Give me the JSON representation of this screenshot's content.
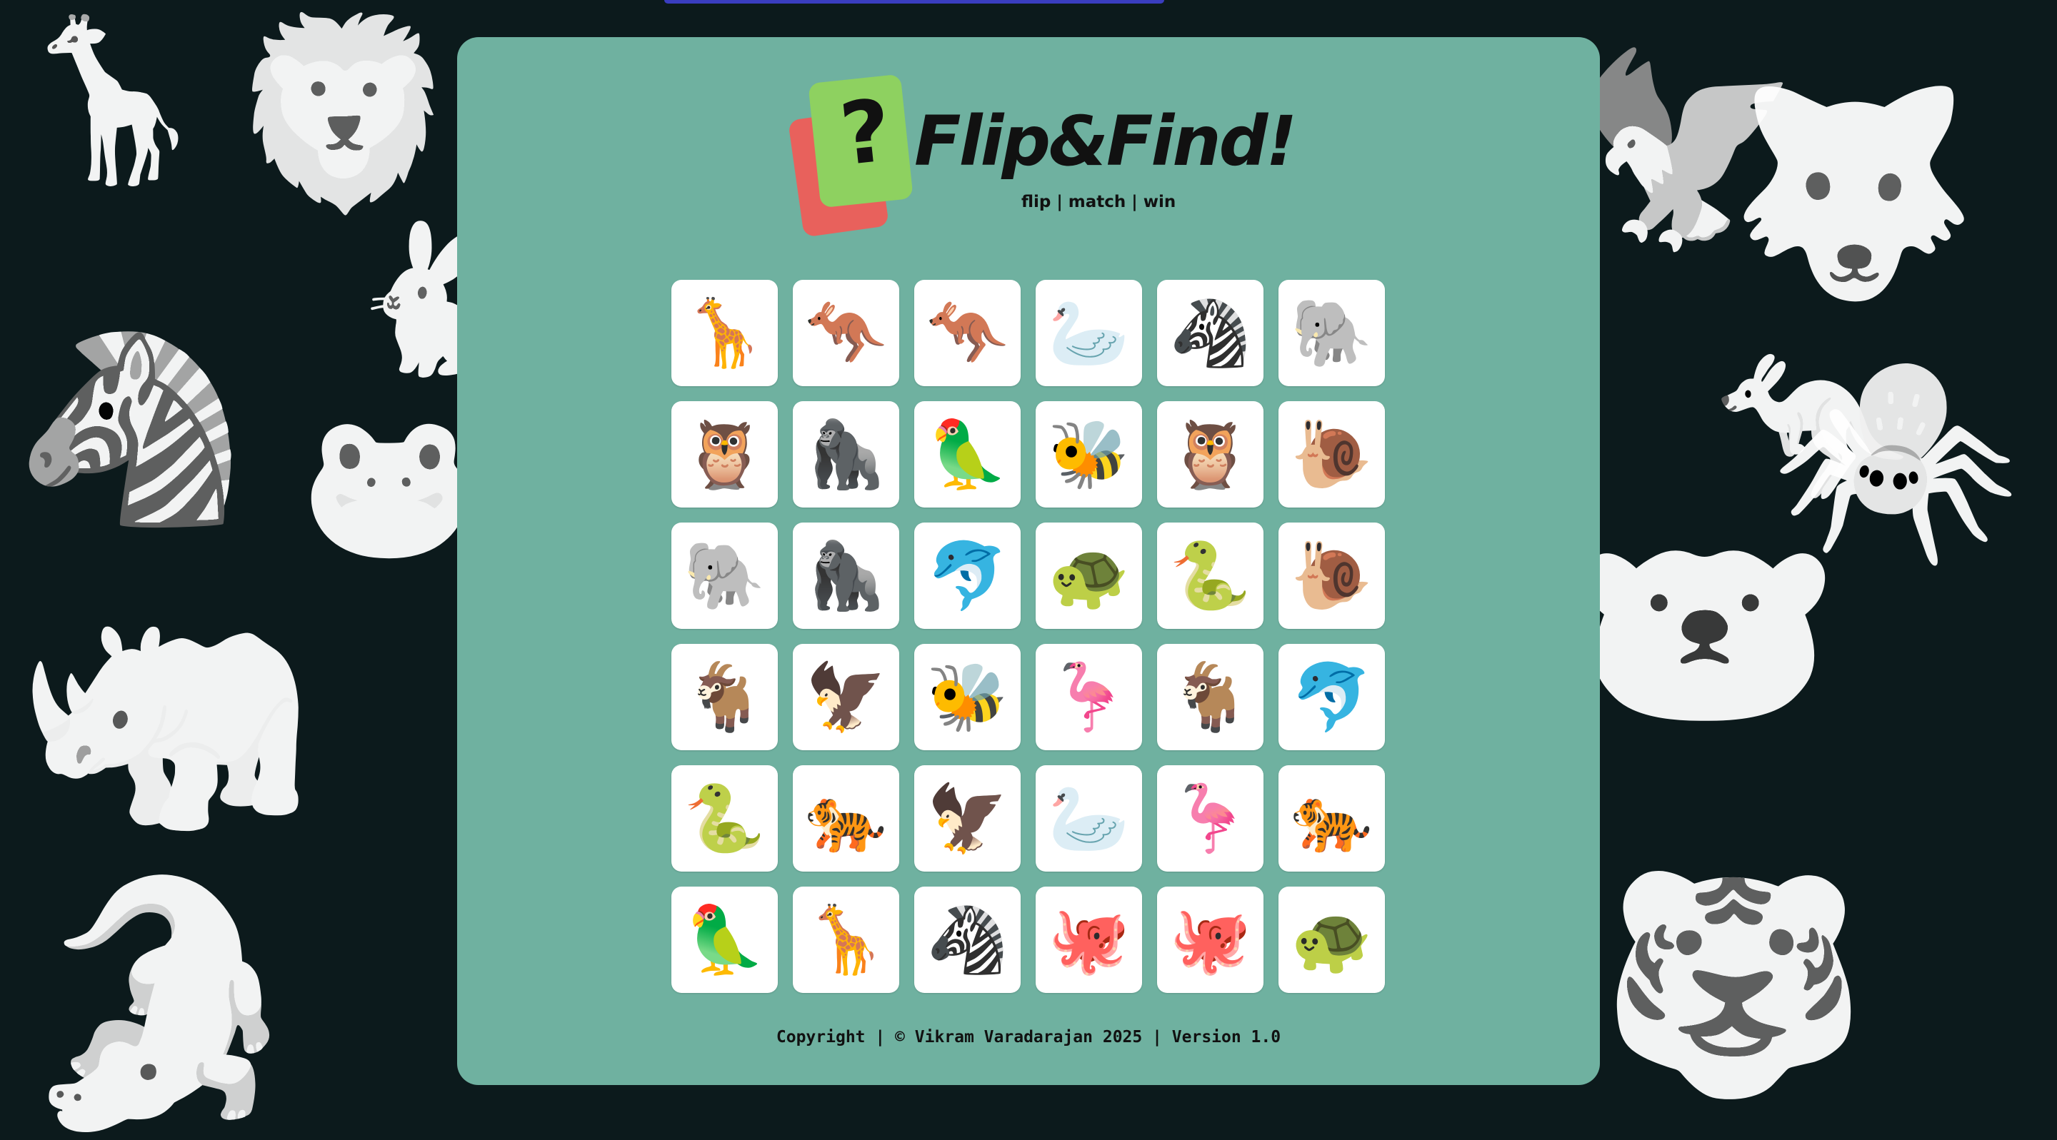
{
  "app": {
    "title": "Flip&Find!",
    "tagline": "flip | match | win"
  },
  "logo": {
    "question_mark": "?",
    "icon": "question-card-icon"
  },
  "background_animals": [
    {
      "glyph": "🦒",
      "name": "giraffe-icon"
    },
    {
      "glyph": "🦁",
      "name": "lion-icon"
    },
    {
      "glyph": "🐇",
      "name": "rabbit-icon"
    },
    {
      "glyph": "🦓",
      "name": "zebra-icon"
    },
    {
      "glyph": "🐸",
      "name": "frog-icon"
    },
    {
      "glyph": "🦏",
      "name": "rhino-icon"
    },
    {
      "glyph": "🐊",
      "name": "crocodile-icon"
    },
    {
      "glyph": "🦅",
      "name": "eagle-icon"
    },
    {
      "glyph": "🐺",
      "name": "wolf-icon"
    },
    {
      "glyph": "🦘",
      "name": "kangaroo-icon"
    },
    {
      "glyph": "🕷️",
      "name": "spider-icon"
    },
    {
      "glyph": "🐻‍❄️",
      "name": "polar-bear-icon"
    },
    {
      "glyph": "🐯",
      "name": "tiger-icon"
    }
  ],
  "grid": {
    "tiles": [
      {
        "emoji": "🦒",
        "name": "giraffe-icon"
      },
      {
        "emoji": "🦘",
        "name": "kangaroo-icon"
      },
      {
        "emoji": "🦘",
        "name": "kangaroo-icon"
      },
      {
        "emoji": "🦢",
        "name": "swan-icon"
      },
      {
        "emoji": "🦓",
        "name": "zebra-icon"
      },
      {
        "emoji": "🐘",
        "name": "elephant-icon"
      },
      {
        "emoji": "🦉",
        "name": "owl-icon"
      },
      {
        "emoji": "🦍",
        "name": "gorilla-icon"
      },
      {
        "emoji": "🦜",
        "name": "parrot-icon"
      },
      {
        "emoji": "🐝",
        "name": "bee-icon"
      },
      {
        "emoji": "🦉",
        "name": "owl-icon"
      },
      {
        "emoji": "🐌",
        "name": "snail-icon"
      },
      {
        "emoji": "🐘",
        "name": "elephant-icon"
      },
      {
        "emoji": "🦍",
        "name": "gorilla-icon"
      },
      {
        "emoji": "🐬",
        "name": "dolphin-icon"
      },
      {
        "emoji": "🐢",
        "name": "turtle-icon"
      },
      {
        "emoji": "🐍",
        "name": "snake-icon"
      },
      {
        "emoji": "🐌",
        "name": "snail-icon"
      },
      {
        "emoji": "🐐",
        "name": "goat-icon"
      },
      {
        "emoji": "🦅",
        "name": "eagle-icon"
      },
      {
        "emoji": "🐝",
        "name": "bee-icon"
      },
      {
        "emoji": "🦩",
        "name": "flamingo-icon"
      },
      {
        "emoji": "🐐",
        "name": "goat-icon"
      },
      {
        "emoji": "🐬",
        "name": "dolphin-icon"
      },
      {
        "emoji": "🐍",
        "name": "snake-icon"
      },
      {
        "emoji": "🐅",
        "name": "tiger-icon"
      },
      {
        "emoji": "🦅",
        "name": "eagle-icon"
      },
      {
        "emoji": "🦢",
        "name": "swan-icon"
      },
      {
        "emoji": "🦩",
        "name": "flamingo-icon"
      },
      {
        "emoji": "🐅",
        "name": "tiger-icon"
      },
      {
        "emoji": "🦜",
        "name": "parrot-icon"
      },
      {
        "emoji": "🦒",
        "name": "giraffe-icon"
      },
      {
        "emoji": "🦓",
        "name": "zebra-icon"
      },
      {
        "emoji": "🐙",
        "name": "octopus-icon"
      },
      {
        "emoji": "🐙",
        "name": "octopus-icon"
      },
      {
        "emoji": "🐢",
        "name": "turtle-icon"
      }
    ]
  },
  "footer": {
    "text": "Copyright | © Vikram Varadarajan 2025 | Version 1.0"
  },
  "colors": {
    "background": "#0c1a1c",
    "panel": "#6fb1a0",
    "tile": "#ffffff",
    "logo_card_front": "#8ed160",
    "logo_card_back": "#e8615c"
  }
}
